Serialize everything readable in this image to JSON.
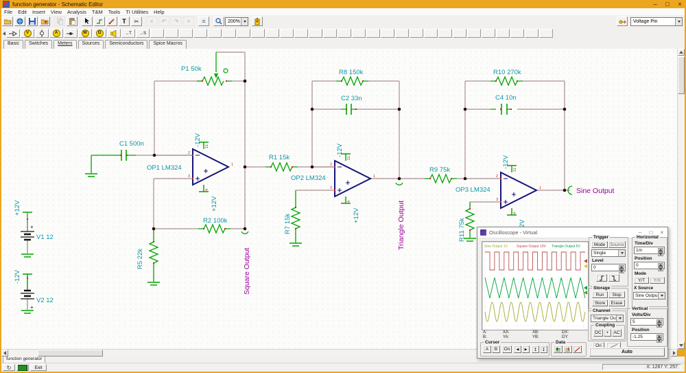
{
  "window": {
    "title": "function generator - Schematic Editor",
    "minimize": "–",
    "maximize": "□",
    "close": "×"
  },
  "menu": {
    "items": [
      "File",
      "Edit",
      "Insert",
      "View",
      "Analysis",
      "T&M",
      "Tools",
      "TI Utilities",
      "Help"
    ]
  },
  "toolbar": {
    "zoom_value": "200%",
    "pin_combo": "Voltage Pin",
    "text_tool": "T",
    "cut_tool": "✂",
    "disabled": {
      "delete": "×",
      "undo": "↶",
      "redo": "↷",
      "plus": "+"
    },
    "list": "≡"
  },
  "palette": {
    "meter_letters": [
      "V",
      "A",
      "W",
      "Ω"
    ],
    "t_label": "→T",
    "s_label": "→S"
  },
  "component_tabs": {
    "items": [
      "Basic",
      "Switches",
      "Meters",
      "Sources",
      "Semiconductors",
      "Spice Macros"
    ],
    "active": "Meters"
  },
  "schematic": {
    "labels": {
      "p1": "P1 50k",
      "c1": "C1 500n",
      "op1": "OP1 LM324",
      "r1": "R1 15k",
      "r2": "R2 100k",
      "r5": "R5 22k",
      "r8": "R8 150k",
      "c2": "C2 33n",
      "op2": "OP2 LM324",
      "r7": "R7 15k",
      "r9": "R9 75k",
      "r10": "R10 270k",
      "c4": "C4 10n",
      "op3": "OP3 LM324",
      "r11": "R11 75k",
      "v1": "V1 12",
      "v2": "V2 12"
    },
    "rails": {
      "pos": "+12V",
      "neg": "-12V"
    },
    "outputs": {
      "square": "Square Output",
      "triangle": "Triangle Output",
      "sine": "Sine Output"
    },
    "pins": {
      "out": "1",
      "inv": "2",
      "ninv": "3",
      "vcc": "4",
      "vee": "11"
    },
    "polarity": "+"
  },
  "oscilloscope": {
    "title": "Oscilloscope - Virtual",
    "legend": [
      {
        "label": "Sine Output  1V",
        "color": "#a8a832"
      },
      {
        "label": "Square Output  10V",
        "color": "#c04848"
      },
      {
        "label": "Triangle Output  5V",
        "color": "#00a33a"
      }
    ],
    "readout": {
      "a": "A:",
      "b": "B:",
      "xa": "XA:",
      "ya": "YA:",
      "xb": "XB:",
      "yb": "YB:",
      "dx": "DX:",
      "dy": "DY:"
    },
    "cursor": {
      "label": "Cursor",
      "a": "A",
      "b": "B",
      "on": "On",
      "left": "◀",
      "right": "▶",
      "up": "↥",
      "down": "↧"
    },
    "data_group": {
      "label": "Data"
    },
    "trigger": {
      "label": "Trigger",
      "mode": "Mode",
      "source": "Source",
      "value": "Single",
      "level_label": "Level",
      "level": "0"
    },
    "storage": {
      "label": "Storage",
      "run": "Run",
      "stop": "Stop",
      "store": "Store",
      "erase": "Erase"
    },
    "channel": {
      "label": "Channel",
      "value": "Triangle Outp",
      "coupling": {
        "label": "Coupling",
        "dc": "DC",
        "plus": "+",
        "ac": "AC"
      },
      "on": "On"
    },
    "horizontal": {
      "label": "Horizontal",
      "timediv_label": "Time/Div",
      "timediv": "1m",
      "position_label": "Position",
      "position": "0",
      "mode_label": "Mode",
      "yt": "Y/T",
      "yx": "Y/X",
      "xsource_label": "X Source",
      "xsource": "Sine Outpu"
    },
    "vertical": {
      "label": "Vertical",
      "voltsdiv_label": "Volts/Div",
      "voltsdiv": "5",
      "position_label": "Position",
      "position": "-1.25"
    },
    "auto": "Auto"
  },
  "sheet_tab": "function generator",
  "bottom_bar": {
    "exit": "Exit"
  },
  "status": {
    "coords": "X: 1267 Y: 257"
  },
  "chart_data": {
    "type": "line",
    "title": "Oscilloscope - Virtual",
    "x_axis": {
      "time_per_div": "1m",
      "cycles_visible": 10.5
    },
    "grid": true,
    "legend_position": "top",
    "series": [
      {
        "name": "Square Output",
        "waveform": "square",
        "volts_per_div": 10,
        "color": "#b65452",
        "cy": 28,
        "amp": 13,
        "cycles": 10.5
      },
      {
        "name": "Triangle Output",
        "waveform": "triangle",
        "volts_per_div": 5,
        "color": "#00a33a",
        "cy": 67,
        "amp": 15,
        "cycles": 10.5
      },
      {
        "name": "Sine Output",
        "waveform": "sine",
        "volts_per_div": 1,
        "color": "#a8a832",
        "cy": 102,
        "amp": 14,
        "cycles": 10.5
      }
    ]
  }
}
